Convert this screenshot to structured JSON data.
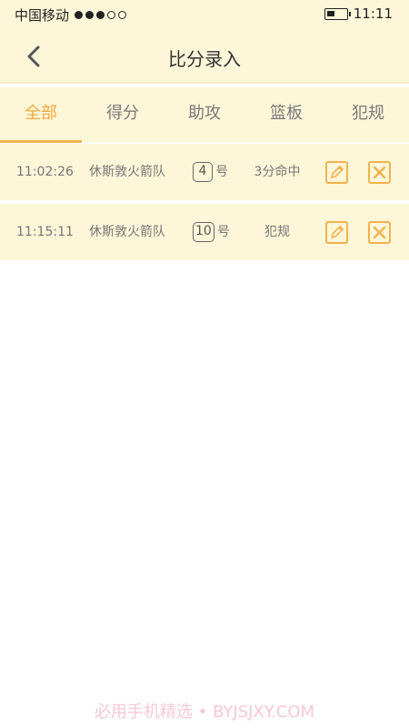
{
  "status": {
    "carrier": "中国移动",
    "time": "11:11",
    "signal_filled": 3,
    "signal_total": 5,
    "battery_level": 0.4
  },
  "nav": {
    "title": "比分录入",
    "back_icon": "chevron-left-icon"
  },
  "tabs": [
    {
      "label": "全部",
      "active": true
    },
    {
      "label": "得分",
      "active": false
    },
    {
      "label": "助攻",
      "active": false
    },
    {
      "label": "篮板",
      "active": false
    },
    {
      "label": "犯规",
      "active": false
    }
  ],
  "records": [
    {
      "time": "11:02:26",
      "team": "休斯敦火箭队",
      "number": "4",
      "number_suffix": "号",
      "event": "3分命中"
    },
    {
      "time": "11:15:11",
      "team": "休斯敦火箭队",
      "number": "10",
      "number_suffix": "号",
      "event": "犯规"
    }
  ],
  "watermark": "必用手机精选 • BYJSJXY.COM",
  "colors": {
    "accent": "#f3b24c",
    "active_tab": "#f3a93c",
    "panel_bg": "#fdf6d9"
  }
}
